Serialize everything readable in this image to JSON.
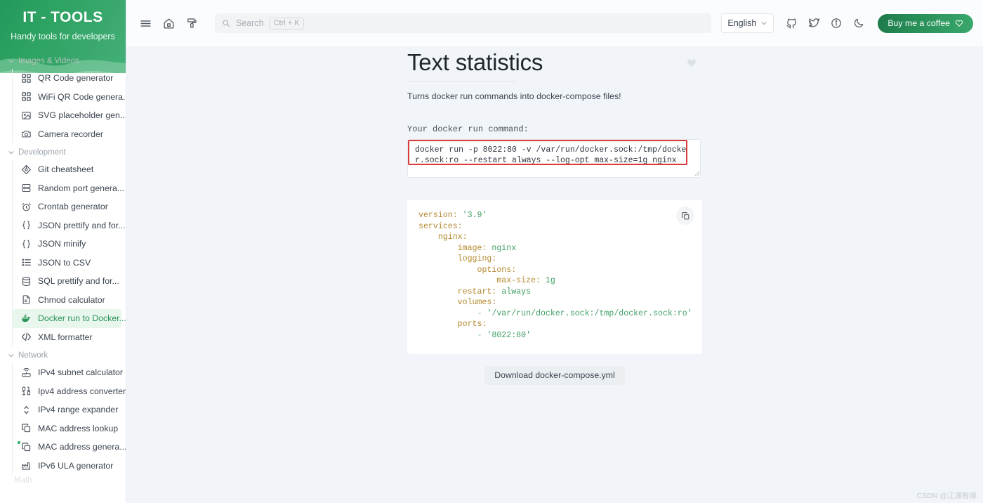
{
  "sidebar": {
    "brand_title": "IT - TOOLS",
    "brand_subtitle": "Handy tools for developers",
    "partial_group_label": "Math",
    "groups": [
      {
        "label": "Images & Videos",
        "items": [
          {
            "label": "QR Code generator",
            "icon": "qr-code-icon",
            "active": false,
            "new": false
          },
          {
            "label": "WiFi QR Code genera...",
            "icon": "qr-code-icon",
            "active": false,
            "new": false
          },
          {
            "label": "SVG placeholder gen...",
            "icon": "image-icon",
            "active": false,
            "new": false
          },
          {
            "label": "Camera recorder",
            "icon": "camera-icon",
            "active": false,
            "new": false
          }
        ]
      },
      {
        "label": "Development",
        "items": [
          {
            "label": "Git cheatsheet",
            "icon": "git-icon",
            "active": false,
            "new": false
          },
          {
            "label": "Random port genera...",
            "icon": "server-icon",
            "active": false,
            "new": false
          },
          {
            "label": "Crontab generator",
            "icon": "alarm-icon",
            "active": false,
            "new": false
          },
          {
            "label": "JSON prettify and for...",
            "icon": "braces-icon",
            "active": false,
            "new": false
          },
          {
            "label": "JSON minify",
            "icon": "braces-icon",
            "active": false,
            "new": false
          },
          {
            "label": "JSON to CSV",
            "icon": "list-icon",
            "active": false,
            "new": false
          },
          {
            "label": "SQL prettify and for...",
            "icon": "database-icon",
            "active": false,
            "new": false
          },
          {
            "label": "Chmod calculator",
            "icon": "file-icon",
            "active": false,
            "new": false
          },
          {
            "label": "Docker run to Docker...",
            "icon": "docker-icon",
            "active": true,
            "new": false
          },
          {
            "label": "XML formatter",
            "icon": "code-icon",
            "active": false,
            "new": false
          }
        ]
      },
      {
        "label": "Network",
        "items": [
          {
            "label": "IPv4 subnet calculator",
            "icon": "router-icon",
            "active": false,
            "new": false
          },
          {
            "label": "Ipv4 address converter",
            "icon": "binary-icon",
            "active": false,
            "new": false
          },
          {
            "label": "IPv4 range expander",
            "icon": "expand-icon",
            "active": false,
            "new": false
          },
          {
            "label": "MAC address lookup",
            "icon": "copy-icon",
            "active": false,
            "new": false
          },
          {
            "label": "MAC address genera...",
            "icon": "copy-icon",
            "active": false,
            "new": true
          },
          {
            "label": "IPv6 ULA generator",
            "icon": "factory-icon",
            "active": false,
            "new": false
          }
        ]
      }
    ]
  },
  "topbar": {
    "menu_icon": "hamburger-icon",
    "home_icon": "home-icon",
    "theme_icon": "paint-roller-icon",
    "search": {
      "placeholder": "Search",
      "shortcut": "Ctrl + K",
      "icon": "search-icon"
    },
    "language": {
      "value": "English",
      "chevron": "chevron-down-icon"
    },
    "icons": [
      {
        "name": "github-icon"
      },
      {
        "name": "twitter-icon"
      },
      {
        "name": "info-icon"
      },
      {
        "name": "moon-icon"
      }
    ],
    "coffee_button": {
      "label": "Buy me a coffee",
      "icon": "heart-icon"
    }
  },
  "main": {
    "title": "Text statistics",
    "favorite_icon": "heart-icon",
    "description": "Turns docker run commands into docker-compose files!",
    "input_label": "Your docker run command:",
    "command_value": "docker run -p 8022:80 -v /var/run/docker.sock:/tmp/docker.sock:ro --restart always --log-opt max-size=1g nginx",
    "copy_icon": "copy-icon",
    "yaml_lines": [
      {
        "indent": 0,
        "key": "version:",
        "value": "'3.9'",
        "dash": false
      },
      {
        "indent": 0,
        "key": "services:",
        "value": "",
        "dash": false
      },
      {
        "indent": 1,
        "key": "nginx:",
        "value": "",
        "dash": false
      },
      {
        "indent": 2,
        "key": "image:",
        "value": "nginx",
        "dash": false
      },
      {
        "indent": 2,
        "key": "logging:",
        "value": "",
        "dash": false
      },
      {
        "indent": 3,
        "key": "options:",
        "value": "",
        "dash": false
      },
      {
        "indent": 4,
        "key": "max-size:",
        "value": "1g",
        "dash": false
      },
      {
        "indent": 2,
        "key": "restart:",
        "value": "always",
        "dash": false
      },
      {
        "indent": 2,
        "key": "volumes:",
        "value": "",
        "dash": false
      },
      {
        "indent": 3,
        "key": "",
        "value": "'/var/run/docker.sock:/tmp/docker.sock:ro'",
        "dash": true
      },
      {
        "indent": 2,
        "key": "ports:",
        "value": "",
        "dash": false
      },
      {
        "indent": 3,
        "key": "",
        "value": "'8022:80'",
        "dash": true
      }
    ],
    "download_label": "Download docker-compose.yml"
  },
  "watermark": "CSDN @江湖有缘",
  "colors": {
    "brand_green": "#2a9159",
    "active_green": "#279455",
    "page_bg": "#f1f5f9",
    "annotation_red": "#d93b3b",
    "yaml_key": "#b5892e",
    "yaml_value": "#3f9e63"
  }
}
